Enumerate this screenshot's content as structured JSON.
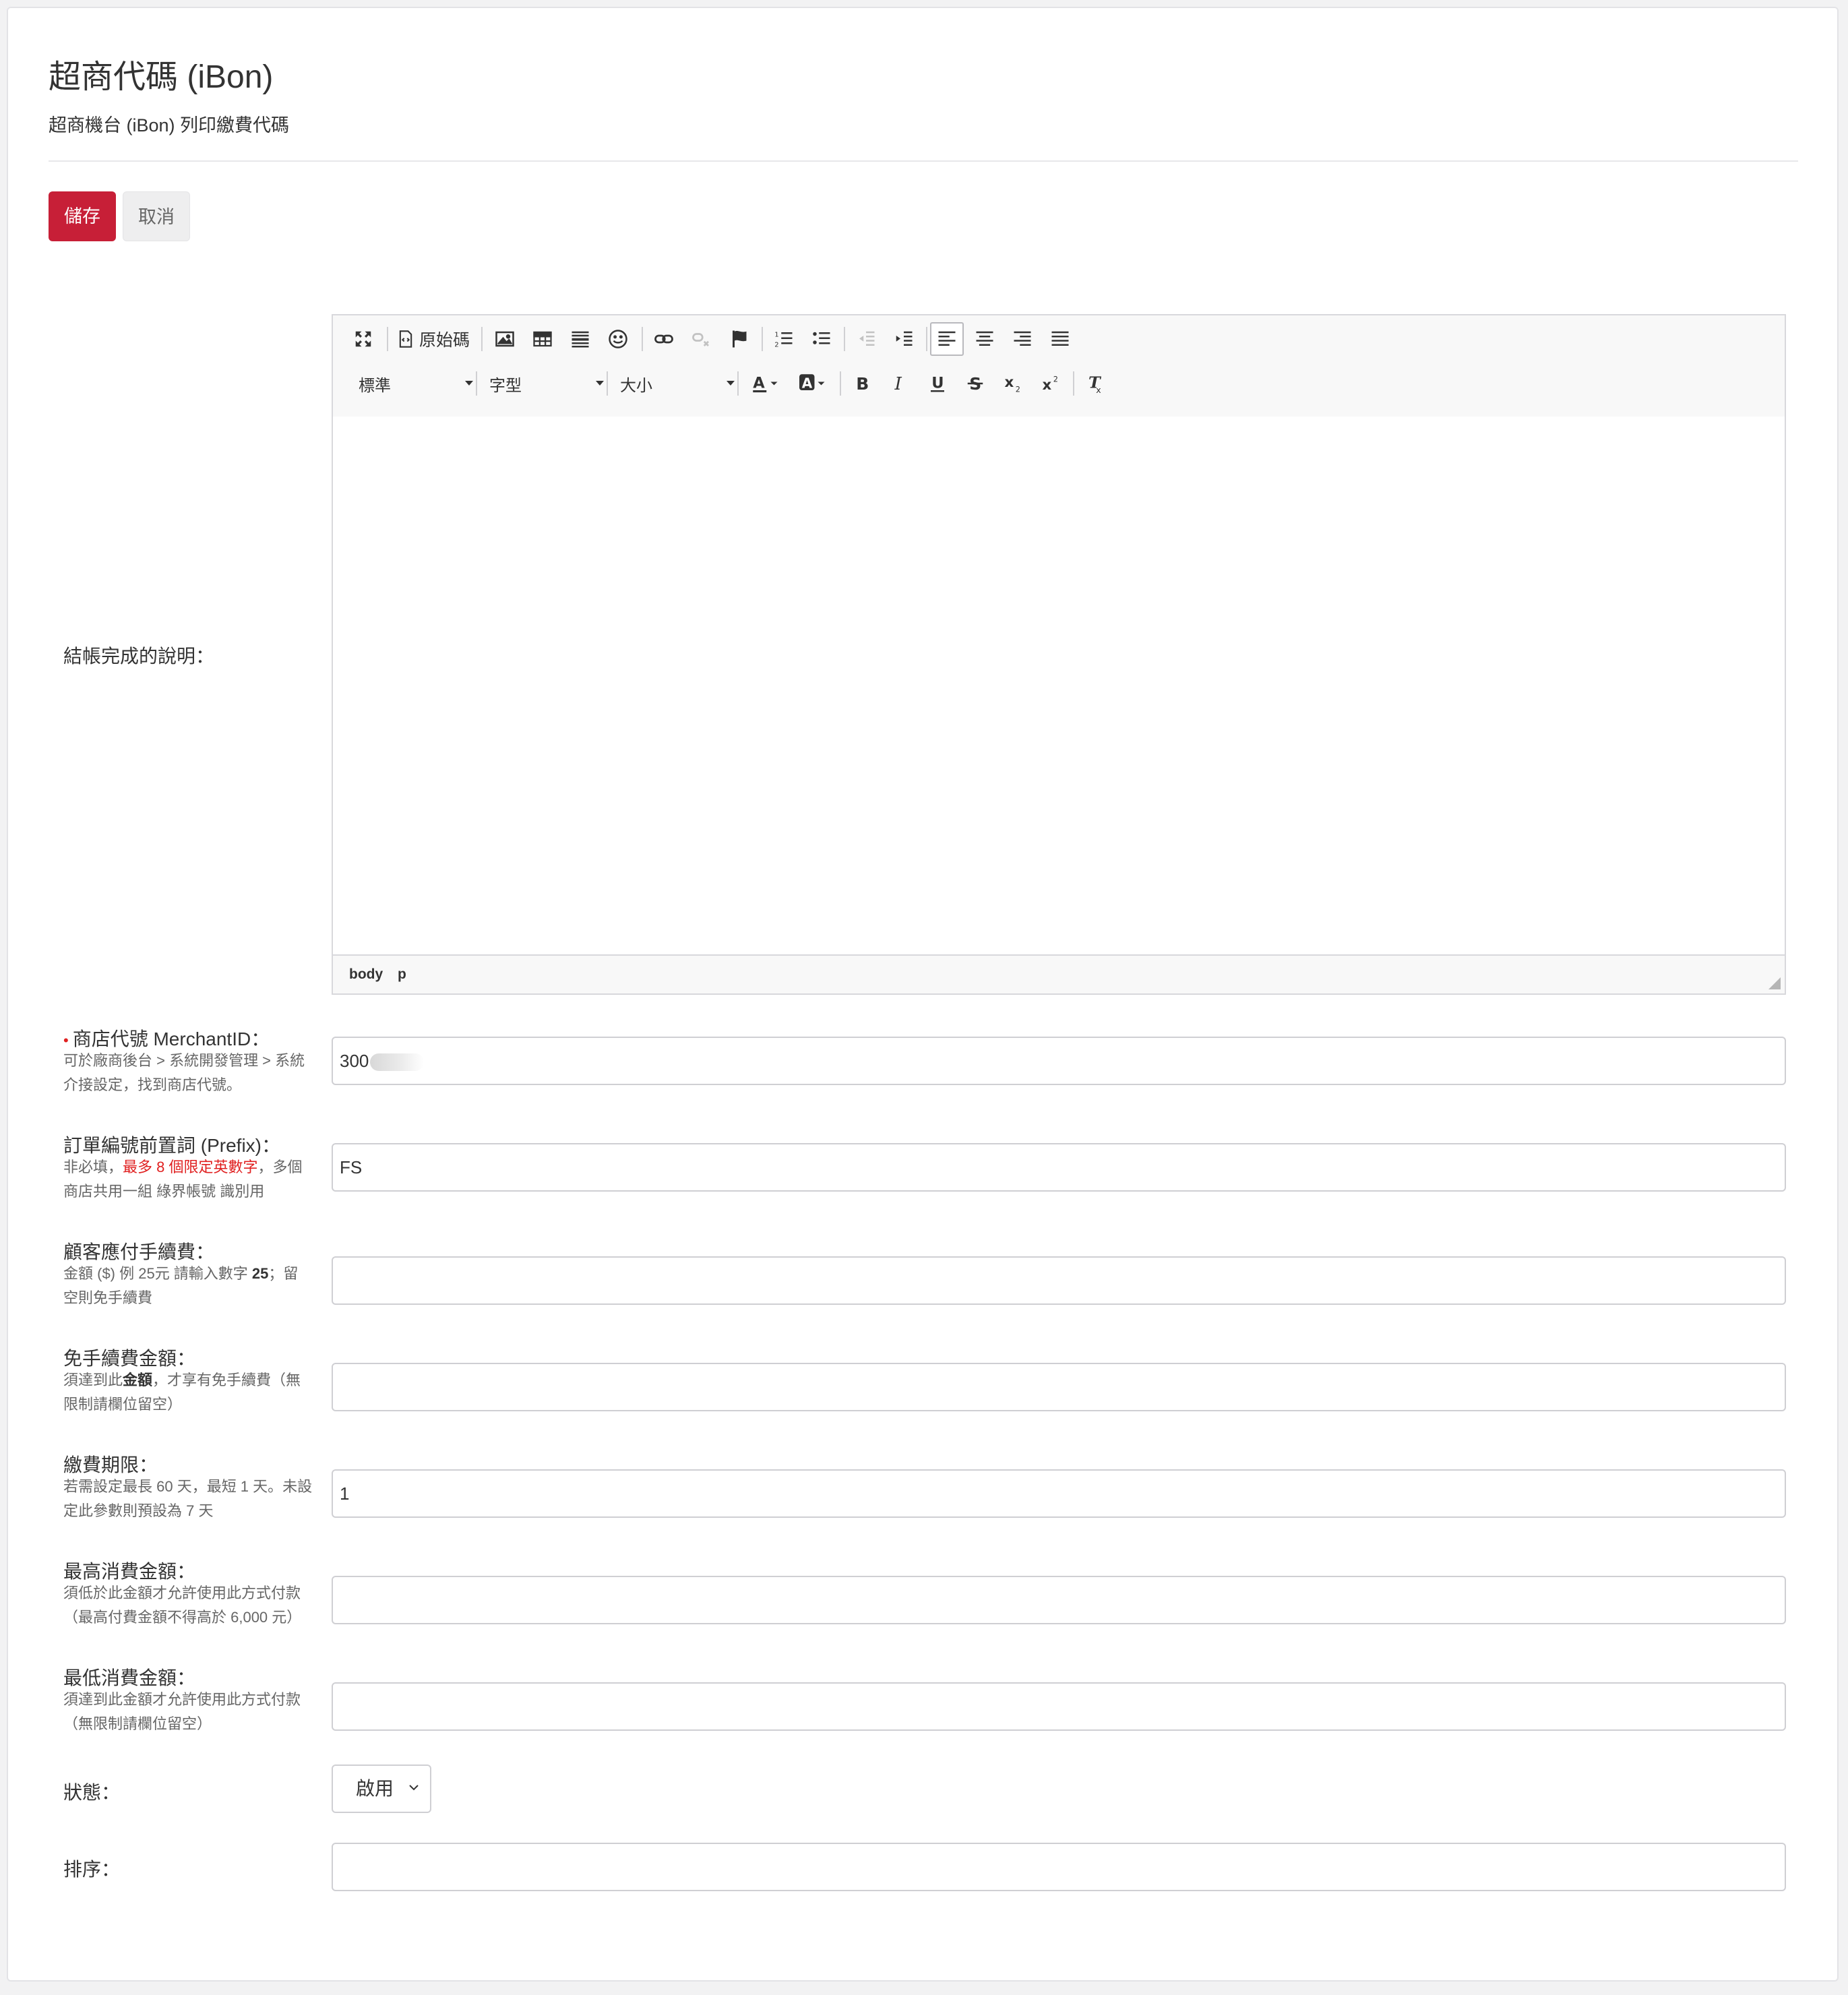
{
  "header": {
    "title": "超商代碼 (iBon)",
    "subtitle": "超商機台 (iBon) 列印繳費代碼"
  },
  "actions": {
    "save_label": "儲存",
    "cancel_label": "取消"
  },
  "colors": {
    "primary": "#c71f37",
    "required_marker": "#e02020"
  },
  "editor": {
    "label": "結帳完成的說明：",
    "source_label": "原始碼",
    "format_combo": "標準",
    "font_combo": "字型",
    "size_combo": "大小",
    "path": [
      "body",
      "p"
    ],
    "content": "",
    "toolbar_icons": [
      "maximize-icon",
      "source-icon",
      "image-icon",
      "table-icon",
      "horizontal-rule-icon",
      "smiley-icon",
      "link-icon",
      "unlink-icon",
      "anchor-icon",
      "numbered-list-icon",
      "bulleted-list-icon",
      "outdent-icon",
      "indent-icon",
      "align-left-icon",
      "align-center-icon",
      "align-right-icon",
      "justify-icon",
      "text-color-icon",
      "background-color-icon",
      "bold-icon",
      "italic-icon",
      "underline-icon",
      "strike-icon",
      "subscript-icon",
      "superscript-icon",
      "remove-format-icon"
    ]
  },
  "fields": {
    "merchant": {
      "required_mark": "•",
      "label": "商店代號 MerchantID：",
      "hint": "可於廠商後台 > 系統開發管理 > 系統介接設定，找到商店代號。",
      "value": "300"
    },
    "prefix": {
      "label": "訂單編號前置詞 (Prefix)：",
      "hint_a": "非必填，",
      "hint_red": "最多 8 個限定英數字",
      "hint_b": "，多個商店共用一組 綠界帳號 識別用",
      "value": "FS"
    },
    "fee": {
      "label": "顧客應付手續費：",
      "hint_a": "金額 ($) 例 25元 請輸入數字 ",
      "hint_bold": "25",
      "hint_b": "；留空則免手續費",
      "value": ""
    },
    "free_fee": {
      "label": "免手續費金額：",
      "hint_a": "須達到此",
      "hint_bold": "金額",
      "hint_b": "，才享有免手續費（無限制請欄位留空）",
      "value": ""
    },
    "deadline": {
      "label": "繳費期限：",
      "hint": "若需設定最長 60 天，最短 1 天。未設定此參數則預設為 7 天",
      "value": "1"
    },
    "max_amount": {
      "label": "最高消費金額：",
      "hint": "須低於此金額才允許使用此方式付款（最高付費金額不得高於 6,000 元）",
      "value": ""
    },
    "min_amount": {
      "label": "最低消費金額：",
      "hint": "須達到此金額才允許使用此方式付款（無限制請欄位留空）",
      "value": ""
    },
    "status": {
      "label": "狀態：",
      "selected": "啟用"
    },
    "sort": {
      "label": "排序：",
      "value": ""
    }
  }
}
